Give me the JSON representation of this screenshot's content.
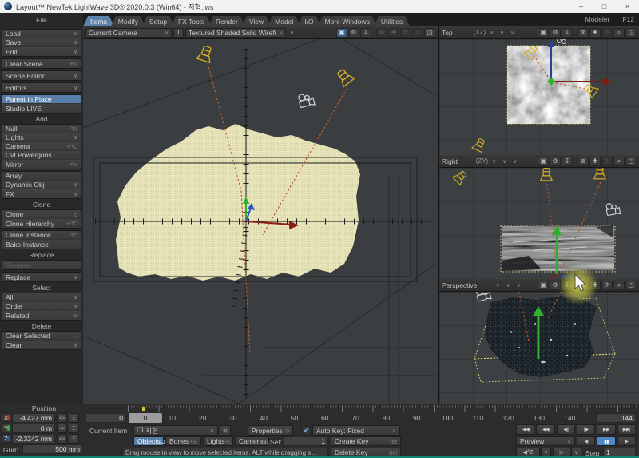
{
  "window": {
    "title": "Layout™ NewTek LightWave 3D® 2020.0.3 (Win64) - 지형.lws",
    "minimize": "–",
    "maximize": "□",
    "close": "×"
  },
  "menubar": {
    "file_header": "File",
    "tabs": [
      "Items",
      "Modify",
      "Setup",
      "FX Tools",
      "Render",
      "View",
      "Model",
      "I/O",
      "More Windows",
      "Utilities"
    ],
    "active_tab": "Items",
    "right": [
      "Modeler",
      "F12"
    ]
  },
  "sidebar": {
    "sections": [
      {
        "header": "",
        "groups": [
          [
            {
              "label": "Load",
              "arrow": true
            },
            {
              "label": "Save",
              "arrow": true
            },
            {
              "label": "Edit",
              "arrow": true
            }
          ],
          [
            {
              "label": "Clear Scene",
              "shortcut": "+N"
            }
          ],
          [
            {
              "label": "Scene Editor",
              "arrow": true
            }
          ],
          [
            {
              "label": "Editors",
              "arrow": true
            }
          ],
          [
            {
              "label": "Parent in Place",
              "active": true
            },
            {
              "label": "Studio LIVE"
            }
          ]
        ]
      },
      {
        "header": "Add",
        "groups": [
          [
            {
              "label": "Null",
              "shortcut": "^N"
            },
            {
              "label": "Lights",
              "arrow": true
            },
            {
              "label": "Camera",
              "shortcut": "+^C"
            },
            {
              "label": "Cvt Powergons"
            },
            {
              "label": "Mirror",
              "shortcut": "+V"
            }
          ],
          [
            {
              "label": "Array"
            },
            {
              "label": "Dynamic Obj",
              "arrow": true
            },
            {
              "label": "FX",
              "arrow": true
            }
          ]
        ]
      },
      {
        "header": "Clone",
        "groups": [
          [
            {
              "label": "Clone",
              "shortcut": "c"
            },
            {
              "label": "Clone Hierarchy",
              "shortcut": "+^C"
            }
          ],
          [
            {
              "label": "Clone Instance",
              "shortcut": "^C"
            },
            {
              "label": "Bake Instance"
            }
          ]
        ]
      },
      {
        "header": "Replace",
        "groups": [
          [
            {
              "label": "Rename",
              "disabled": true
            }
          ],
          [
            {
              "label": "Replace",
              "arrow": true
            }
          ]
        ]
      },
      {
        "header": "Select",
        "groups": [
          [
            {
              "label": "All",
              "arrow": true
            },
            {
              "label": "Order",
              "arrow": true
            },
            {
              "label": "Related",
              "arrow": true
            }
          ]
        ]
      },
      {
        "header": "Delete",
        "groups": [
          [
            {
              "label": "Clear Selected",
              "shortcut": "-"
            },
            {
              "label": "Clear",
              "arrow": true
            }
          ]
        ]
      }
    ]
  },
  "main_viewport": {
    "camera_select": "Current Camera",
    "shading_toggle": "T",
    "shading_select": "Textured Shaded Solid Wireframe"
  },
  "viewports": {
    "top": {
      "name": "Top",
      "axis": "(XZ)"
    },
    "right": {
      "name": "Right",
      "axis": "(ZY)"
    },
    "perspective": {
      "name": "Perspective",
      "axis": ""
    }
  },
  "viewport_icons": [
    {
      "name": "photo-camera",
      "glyph": "▣"
    },
    {
      "name": "gear",
      "glyph": "⚙"
    },
    {
      "name": "export",
      "glyph": "↧"
    },
    {
      "name": "rotate",
      "glyph": "⊗"
    },
    {
      "name": "pan",
      "glyph": "✚"
    },
    {
      "name": "orbit",
      "glyph": "⟳"
    },
    {
      "name": "zoom",
      "glyph": "⌕"
    },
    {
      "name": "maximize",
      "glyph": "◳"
    }
  ],
  "ui": {
    "arrow_glyph": "∨",
    "check_glyph": "✔",
    "cycle_glyph": "<>",
    "envelope_glyph": "E",
    "cube_glyph": "❒",
    "grid_button_glyph": "⊞"
  },
  "bottom": {
    "position_label": "Position",
    "axes": [
      {
        "axis": "X",
        "value": "-4.427 mm",
        "color": "#c23227"
      },
      {
        "axis": "Y",
        "value": "0 m",
        "color": "#2fae2f"
      },
      {
        "axis": "Z",
        "value": "-2.3242 mm",
        "color": "#2c55c8"
      }
    ],
    "grid_label": "Grid:",
    "grid_value": "500 mm",
    "timeline": {
      "start": "0",
      "end": "144",
      "current": "0",
      "ticks": [
        "0",
        "10",
        "20",
        "30",
        "40",
        "50",
        "60",
        "70",
        "80",
        "90",
        "100",
        "110",
        "120",
        "130",
        "140"
      ]
    },
    "current_item_label": "Current Item",
    "current_item": "지형",
    "properties_label": "Properties",
    "properties_key": "p",
    "autokey_label": "Auto Key: Fixed",
    "item_types": [
      {
        "label": "Objects",
        "key": "O",
        "active": true
      },
      {
        "label": "Bones",
        "key": "+B"
      },
      {
        "label": "Lights",
        "key": "+L"
      },
      {
        "label": "Cameras",
        "key": "C"
      }
    ],
    "sel_label": "Sel:",
    "sel_value": "1",
    "create_key_label": "Create Key",
    "create_key_key": "ret",
    "delete_key_label": "Delete Key",
    "delete_key_key": "del",
    "status": "Drag mouse in view to move selected items. ALT while dragging s...",
    "transport": [
      {
        "name": "goto-start",
        "glyph": "|◀◀"
      },
      {
        "name": "prev-key",
        "glyph": "◀◀"
      },
      {
        "name": "step-back",
        "glyph": "◀||"
      },
      {
        "name": "step-forward",
        "glyph": "||▶"
      },
      {
        "name": "next-key",
        "glyph": "▶▶"
      },
      {
        "name": "goto-end",
        "glyph": "▶▶|"
      }
    ],
    "preview_label": "Preview",
    "play_controls": [
      {
        "name": "play-reverse",
        "glyph": "◀"
      },
      {
        "name": "pause",
        "glyph": "▮▮",
        "active": true
      },
      {
        "name": "play-forward",
        "glyph": "▶"
      }
    ],
    "undo_label": "◀^Z",
    "redo_label": "|▶",
    "step_label": "Step",
    "step_value": "1"
  },
  "colors": {
    "accent_blue": "#567ea8",
    "light_yellow": "#d4ac1e",
    "dash_orange": "#b95e2c",
    "arrow_green": "#33b033",
    "terrain_cream": "#e9e5ba",
    "teal_border": "#0e8573"
  }
}
